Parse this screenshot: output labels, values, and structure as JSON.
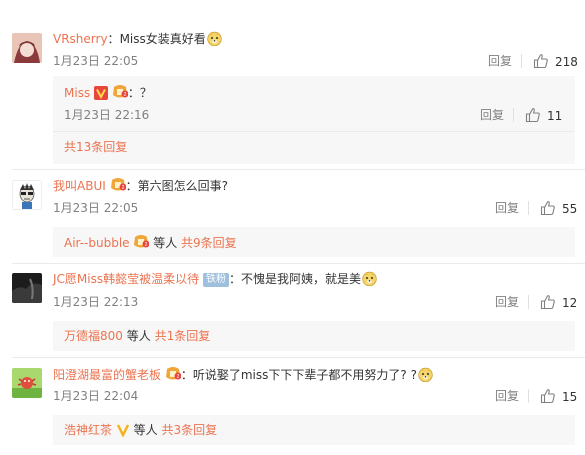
{
  "comments": [
    {
      "user": "VRsherry",
      "sep": "：",
      "text": "Miss女装真好看",
      "time": "1月23日 22:05",
      "reply_label": "回复",
      "likes": "218",
      "sub_reply": {
        "user": "Miss",
        "sep": "：",
        "text": "？",
        "time": "1月23日 22:16",
        "reply_label": "回复",
        "likes": "11"
      },
      "thread_link": "共13条回复"
    },
    {
      "user": "我叫ABUI",
      "sep": "：",
      "text": "第六图怎么回事?",
      "time": "1月23日 22:05",
      "reply_label": "回复",
      "likes": "55",
      "thread": {
        "who": "Air--bubble",
        "mid": "等人",
        "count": "共9条回复"
      }
    },
    {
      "user": "JC愿Miss韩懿莹被温柔以待",
      "badge_text": "铁粉",
      "sep": "：",
      "text": "不愧是我阿姨，就是美",
      "time": "1月23日 22:13",
      "reply_label": "回复",
      "likes": "12",
      "thread": {
        "who": "万德福800",
        "mid": "等人",
        "count": "共1条回复"
      }
    },
    {
      "user": "阳澄湖最富的蟹老板",
      "sep": "：",
      "text": "听说娶了miss下下下辈子都不用努力了? ?",
      "time": "1月23日 22:04",
      "reply_label": "回复",
      "likes": "15",
      "thread": {
        "who": "浩神红茶",
        "mid": "等人",
        "count": "共3条回复"
      }
    }
  ],
  "colors": {
    "link": "#eb7350",
    "meta": "#808080",
    "subbox": "#f7f7f7",
    "tiefen": "#9ec0de"
  },
  "icons": [
    "avatar",
    "thumb-up-icon",
    "doge-emoji",
    "vip-badge-icon",
    "fan-badge-icon",
    "verified-v-icon"
  ]
}
